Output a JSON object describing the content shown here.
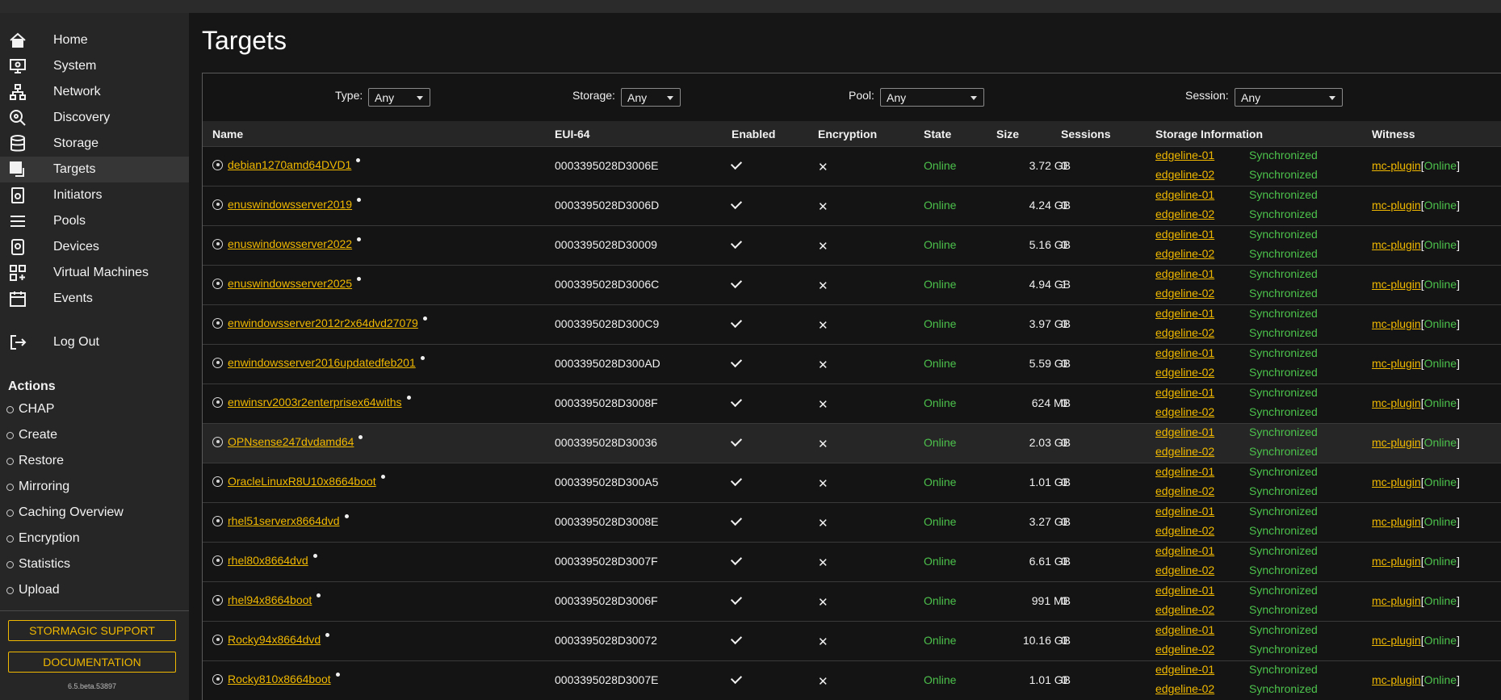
{
  "sidebar": {
    "nav": [
      {
        "label": "Home",
        "icon": "home-icon"
      },
      {
        "label": "System",
        "icon": "system-icon"
      },
      {
        "label": "Network",
        "icon": "network-icon"
      },
      {
        "label": "Discovery",
        "icon": "discovery-icon"
      },
      {
        "label": "Storage",
        "icon": "storage-icon"
      },
      {
        "label": "Targets",
        "icon": "targets-icon",
        "active": true
      },
      {
        "label": "Initiators",
        "icon": "initiators-icon"
      },
      {
        "label": "Pools",
        "icon": "pools-icon"
      },
      {
        "label": "Devices",
        "icon": "devices-icon"
      },
      {
        "label": "Virtual Machines",
        "icon": "virtual-machines-icon"
      },
      {
        "label": "Events",
        "icon": "events-icon"
      }
    ],
    "logout_label": "Log Out",
    "actions_title": "Actions",
    "actions": [
      "CHAP",
      "Create",
      "Restore",
      "Mirroring",
      "Caching Overview",
      "Encryption",
      "Statistics",
      "Upload"
    ],
    "support_label": "STORMAGIC SUPPORT",
    "docs_label": "DOCUMENTATION",
    "version": "6.5.beta.53897"
  },
  "page": {
    "title": "Targets"
  },
  "filters": {
    "type": {
      "label": "Type:",
      "value": "Any"
    },
    "storage": {
      "label": "Storage:",
      "value": "Any"
    },
    "pool": {
      "label": "Pool:",
      "value": "Any"
    },
    "session": {
      "label": "Session:",
      "value": "Any"
    }
  },
  "table": {
    "headers": {
      "name": "Name",
      "eui": "EUI-64",
      "enabled": "Enabled",
      "encryption": "Encryption",
      "state": "State",
      "size": "Size",
      "sessions": "Sessions",
      "storage": "Storage Information",
      "witness": "Witness"
    },
    "rows": [
      {
        "name": "debian1270amd64DVD1",
        "eui": "0003395028D3006E",
        "state": "Online",
        "size": "3.72 GB",
        "sessions": "0",
        "node1": "edgeline-01",
        "sync1": "Synchronized",
        "node2": "edgeline-02",
        "sync2": "Synchronized",
        "witness": "mc-plugin",
        "witness_state": "Online"
      },
      {
        "name": "enuswindowsserver2019",
        "eui": "0003395028D3006D",
        "state": "Online",
        "size": "4.24 GB",
        "sessions": "0",
        "node1": "edgeline-01",
        "sync1": "Synchronized",
        "node2": "edgeline-02",
        "sync2": "Synchronized",
        "witness": "mc-plugin",
        "witness_state": "Online"
      },
      {
        "name": "enuswindowsserver2022",
        "eui": "0003395028D30009",
        "state": "Online",
        "size": "5.16 GB",
        "sessions": "0",
        "node1": "edgeline-01",
        "sync1": "Synchronized",
        "node2": "edgeline-02",
        "sync2": "Synchronized",
        "witness": "mc-plugin",
        "witness_state": "Online"
      },
      {
        "name": "enuswindowsserver2025",
        "eui": "0003395028D3006C",
        "state": "Online",
        "size": "4.94 GB",
        "sessions": "1",
        "node1": "edgeline-01",
        "sync1": "Synchronized",
        "node2": "edgeline-02",
        "sync2": "Synchronized",
        "witness": "mc-plugin",
        "witness_state": "Online"
      },
      {
        "name": "enwindowsserver2012r2x64dvd27079",
        "eui": "0003395028D300C9",
        "state": "Online",
        "size": "3.97 GB",
        "sessions": "0",
        "node1": "edgeline-01",
        "sync1": "Synchronized",
        "node2": "edgeline-02",
        "sync2": "Synchronized",
        "witness": "mc-plugin",
        "witness_state": "Online"
      },
      {
        "name": "enwindowsserver2016updatedfeb201",
        "eui": "0003395028D300AD",
        "state": "Online",
        "size": "5.59 GB",
        "sessions": "0",
        "node1": "edgeline-01",
        "sync1": "Synchronized",
        "node2": "edgeline-02",
        "sync2": "Synchronized",
        "witness": "mc-plugin",
        "witness_state": "Online"
      },
      {
        "name": "enwinsrv2003r2enterprisex64withs",
        "eui": "0003395028D3008F",
        "state": "Online",
        "size": "624 MB",
        "sessions": "0",
        "node1": "edgeline-01",
        "sync1": "Synchronized",
        "node2": "edgeline-02",
        "sync2": "Synchronized",
        "witness": "mc-plugin",
        "witness_state": "Online"
      },
      {
        "name": "OPNsense247dvdamd64",
        "eui": "0003395028D30036",
        "state": "Online",
        "size": "2.03 GB",
        "sessions": "0",
        "node1": "edgeline-01",
        "sync1": "Synchronized",
        "node2": "edgeline-02",
        "sync2": "Synchronized",
        "witness": "mc-plugin",
        "witness_state": "Online",
        "highlight": true
      },
      {
        "name": "OracleLinuxR8U10x8664boot",
        "eui": "0003395028D300A5",
        "state": "Online",
        "size": "1.01 GB",
        "sessions": "0",
        "node1": "edgeline-01",
        "sync1": "Synchronized",
        "node2": "edgeline-02",
        "sync2": "Synchronized",
        "witness": "mc-plugin",
        "witness_state": "Online"
      },
      {
        "name": "rhel51serverx8664dvd",
        "eui": "0003395028D3008E",
        "state": "Online",
        "size": "3.27 GB",
        "sessions": "0",
        "node1": "edgeline-01",
        "sync1": "Synchronized",
        "node2": "edgeline-02",
        "sync2": "Synchronized",
        "witness": "mc-plugin",
        "witness_state": "Online"
      },
      {
        "name": "rhel80x8664dvd",
        "eui": "0003395028D3007F",
        "state": "Online",
        "size": "6.61 GB",
        "sessions": "0",
        "node1": "edgeline-01",
        "sync1": "Synchronized",
        "node2": "edgeline-02",
        "sync2": "Synchronized",
        "witness": "mc-plugin",
        "witness_state": "Online"
      },
      {
        "name": "rhel94x8664boot",
        "eui": "0003395028D3006F",
        "state": "Online",
        "size": "991 MB",
        "sessions": "0",
        "node1": "edgeline-01",
        "sync1": "Synchronized",
        "node2": "edgeline-02",
        "sync2": "Synchronized",
        "witness": "mc-plugin",
        "witness_state": "Online"
      },
      {
        "name": "Rocky94x8664dvd",
        "eui": "0003395028D30072",
        "state": "Online",
        "size": "10.16 GB",
        "sessions": "0",
        "node1": "edgeline-01",
        "sync1": "Synchronized",
        "node2": "edgeline-02",
        "sync2": "Synchronized",
        "witness": "mc-plugin",
        "witness_state": "Online"
      },
      {
        "name": "Rocky810x8664boot",
        "eui": "0003395028D3007E",
        "state": "Online",
        "size": "1.01 GB",
        "sessions": "0",
        "node1": "edgeline-01",
        "sync1": "Synchronized",
        "node2": "edgeline-02",
        "sync2": "Synchronized",
        "witness": "mc-plugin",
        "witness_state": "Online"
      }
    ]
  },
  "colors": {
    "accent": "#f0b800",
    "online": "#4cc24c",
    "sidebar": "#262626",
    "background": "#161616"
  }
}
